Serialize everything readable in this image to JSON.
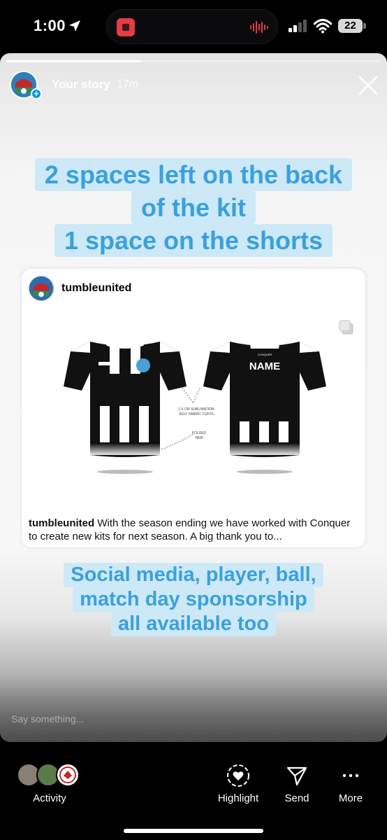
{
  "status_bar": {
    "time": "1:00",
    "battery": "22"
  },
  "story": {
    "progress": 0.36,
    "username": "Your story",
    "time_ago": "17m",
    "headline_lines": [
      "2 spaces left on the back",
      "of the kit",
      "1 space on the shorts"
    ],
    "subtext_lines": [
      "Social media, player, ball,",
      "match day sponsorship",
      "all available too"
    ],
    "reply_placeholder": "Say something..."
  },
  "post": {
    "username": "tumbleunited",
    "caption_user": "tumbleunited",
    "caption_text": "With the season ending we have worked with Conquer to create new kits for next season. A big thank you to...",
    "image_labels": {
      "name": "NAME",
      "cuffs_line1": "1.5 CM SUBLIMATION",
      "cuffs_line2": "SELF FABRIC CUFFS",
      "hem_line1": "FOLDED",
      "hem_line2": "HEM",
      "brand": "CONQUER"
    }
  },
  "bottom_bar": {
    "activity_label": "Activity",
    "highlight_label": "Highlight",
    "send_label": "Send",
    "more_label": "More"
  },
  "icons": [
    "location-arrow-icon",
    "cellular-signal-icon",
    "wifi-icon",
    "battery-icon",
    "close-icon",
    "multiple-images-icon",
    "highlight-heart-icon",
    "send-icon",
    "more-dots-icon"
  ],
  "colors": {
    "sticker_bg": "#cde9f8",
    "sticker_text": "#3aa0dd",
    "plus_badge": "#0095f6"
  }
}
